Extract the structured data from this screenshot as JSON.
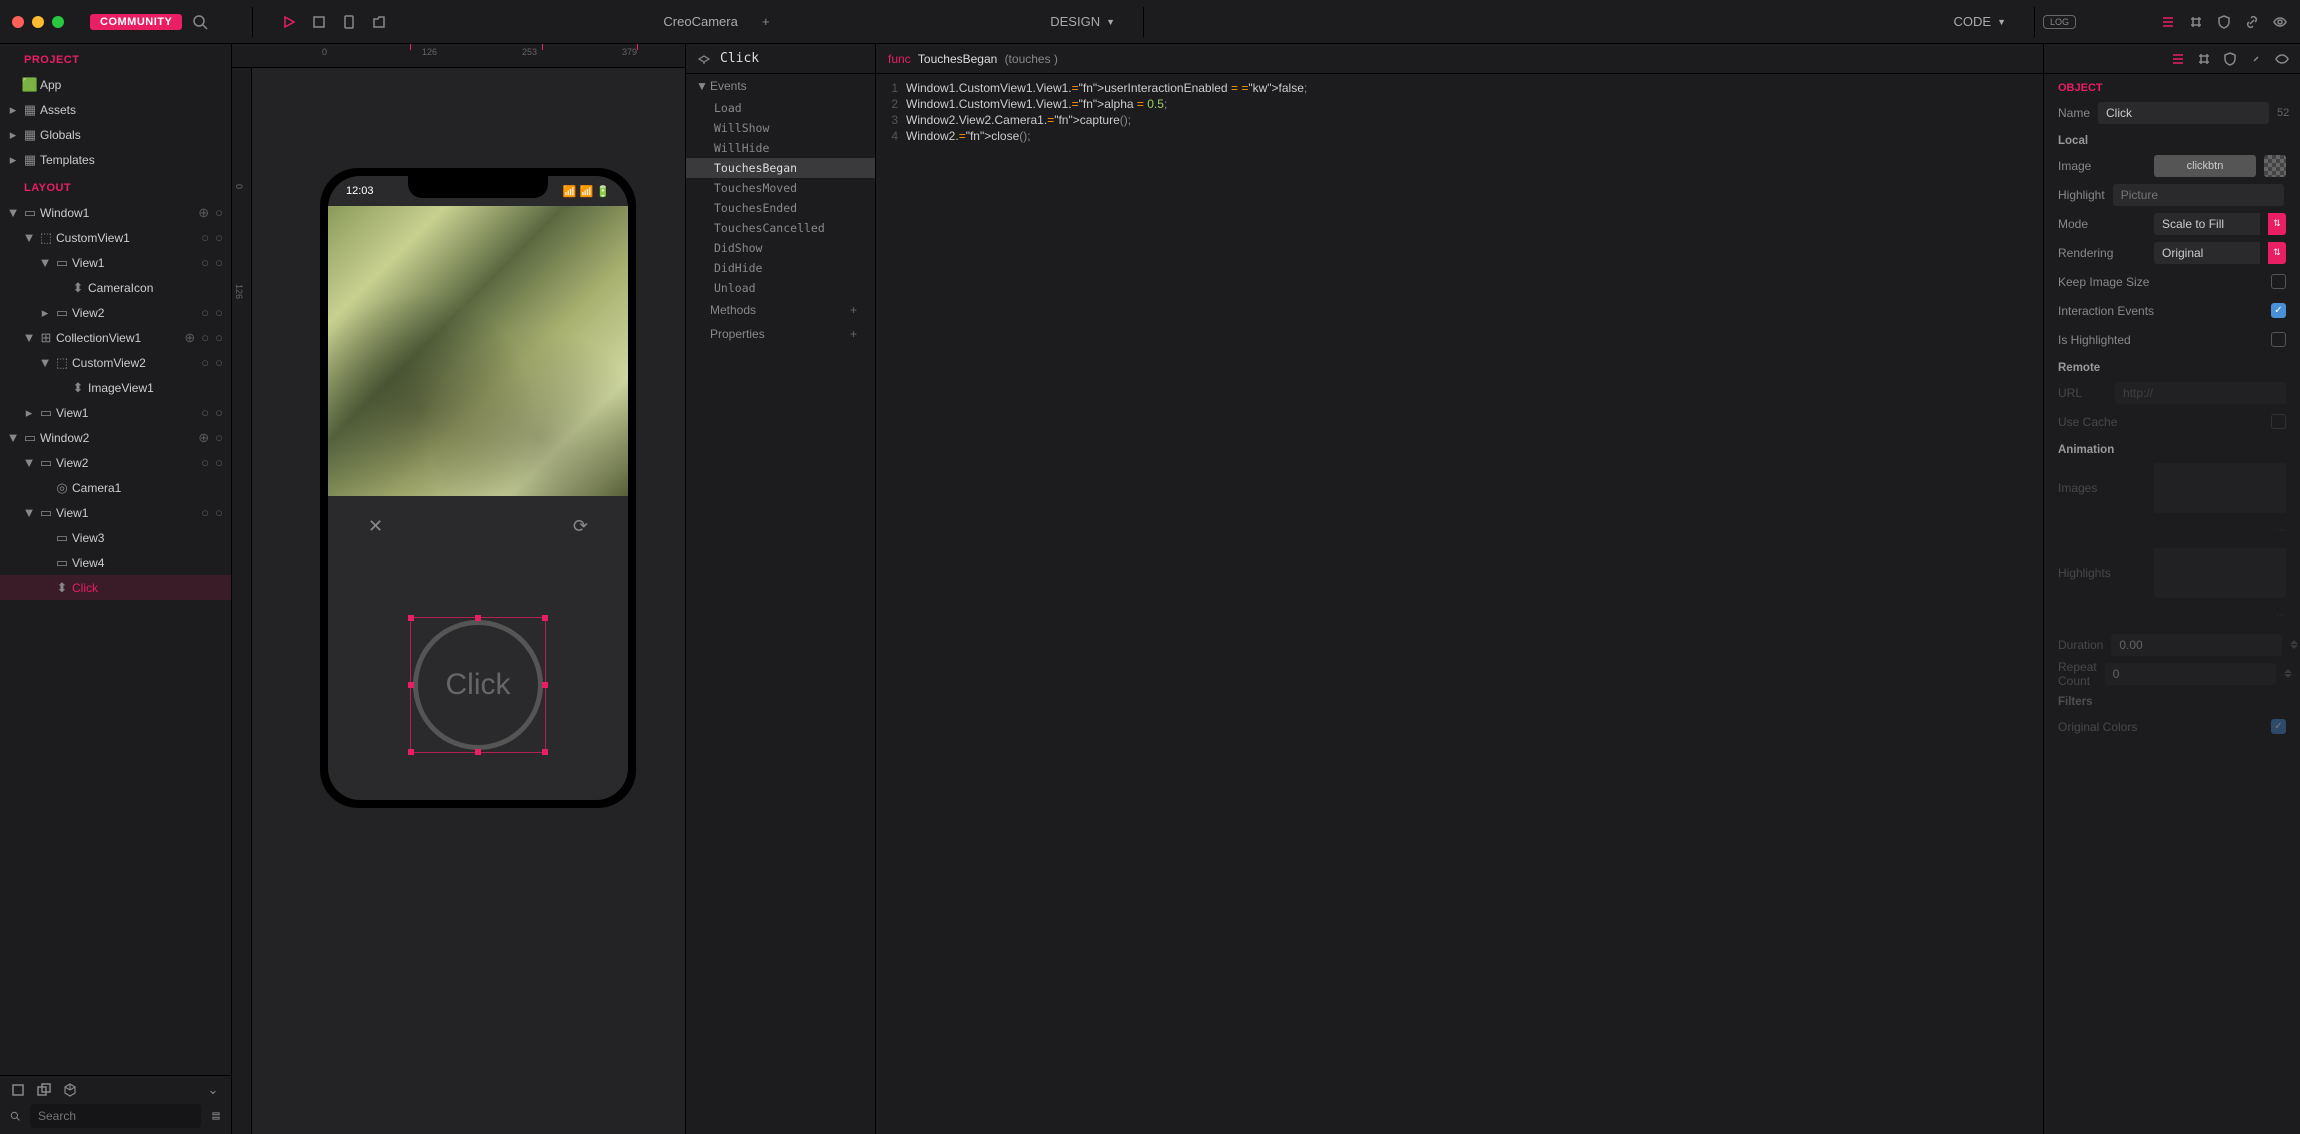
{
  "titlebar": {
    "community": "COMMUNITY",
    "projectName": "CreoCamera",
    "designMode": "DESIGN",
    "codeMode": "CODE",
    "log": "LOG"
  },
  "left": {
    "projectHdr": "PROJECT",
    "layoutHdr": "LAYOUT",
    "projectItems": [
      {
        "label": "App",
        "icon": "app"
      },
      {
        "label": "Assets",
        "icon": "folder"
      },
      {
        "label": "Globals",
        "icon": "globals"
      },
      {
        "label": "Templates",
        "icon": "templates"
      }
    ],
    "layoutTree": [
      {
        "label": "Window1",
        "ind": 0,
        "open": true,
        "icon": "window",
        "add": true,
        "dot": true
      },
      {
        "label": "CustomView1",
        "ind": 1,
        "open": true,
        "icon": "customview",
        "dot": true,
        "dot2": true
      },
      {
        "label": "View1",
        "ind": 2,
        "open": true,
        "icon": "view",
        "dot": true,
        "dot2": true
      },
      {
        "label": "CameraIcon",
        "ind": 3,
        "icon": "image"
      },
      {
        "label": "View2",
        "ind": 2,
        "closed": true,
        "icon": "view",
        "dot": true,
        "dot2": true
      },
      {
        "label": "CollectionView1",
        "ind": 1,
        "open": true,
        "icon": "collection",
        "add": true,
        "dot": true,
        "dot2": true
      },
      {
        "label": "CustomView2",
        "ind": 2,
        "open": true,
        "icon": "customview",
        "dot": true,
        "dot2": true
      },
      {
        "label": "ImageView1",
        "ind": 3,
        "icon": "image"
      },
      {
        "label": "View1",
        "ind": 1,
        "closed": true,
        "icon": "view",
        "dot": true,
        "dot2": true
      },
      {
        "label": "Window2",
        "ind": 0,
        "open": true,
        "icon": "window",
        "add": true,
        "dot": true
      },
      {
        "label": "View2",
        "ind": 1,
        "open": true,
        "icon": "view",
        "dot": true,
        "dot2": true
      },
      {
        "label": "Camera1",
        "ind": 2,
        "icon": "camera"
      },
      {
        "label": "View1",
        "ind": 1,
        "open": true,
        "icon": "view",
        "dot": true,
        "dot2": true
      },
      {
        "label": "View3",
        "ind": 2,
        "icon": "view"
      },
      {
        "label": "View4",
        "ind": 2,
        "icon": "view"
      },
      {
        "label": "Click",
        "ind": 2,
        "icon": "image",
        "selected": true
      }
    ],
    "searchPlaceholder": "Search"
  },
  "canvas": {
    "rulerTop": [
      "0",
      "126",
      "253",
      "379"
    ],
    "rulerLeft": [
      "0",
      "126"
    ],
    "statusTime": "12:03",
    "clickLabel": "Click"
  },
  "events": {
    "title": "Click",
    "sections": {
      "events": "Events",
      "methods": "Methods",
      "properties": "Properties"
    },
    "items": [
      "Load",
      "WillShow",
      "WillHide",
      "TouchesBegan",
      "TouchesMoved",
      "TouchesEnded",
      "TouchesCancelled",
      "DidShow",
      "DidHide",
      "Unload"
    ],
    "selected": "TouchesBegan"
  },
  "code": {
    "signature": {
      "kw": "func",
      "name": "TouchesBegan",
      "params": "(touches )"
    },
    "lines": [
      "Window1.CustomView1.View1.userInteractionEnabled = false;",
      "Window1.CustomView1.View1.alpha = 0.5;",
      "Window2.View2.Camera1.capture();",
      "Window2.close();"
    ]
  },
  "inspector": {
    "hdr": "OBJECT",
    "name": {
      "label": "Name",
      "value": "Click",
      "num": "52"
    },
    "local": "Local",
    "image": {
      "label": "Image",
      "value": "clickbtn"
    },
    "highlight": {
      "label": "Highlight",
      "placeholder": "Picture"
    },
    "mode": {
      "label": "Mode",
      "value": "Scale to Fill"
    },
    "rendering": {
      "label": "Rendering",
      "value": "Original"
    },
    "keepImageSize": {
      "label": "Keep Image Size",
      "on": false
    },
    "interactionEvents": {
      "label": "Interaction Events",
      "on": true
    },
    "isHighlighted": {
      "label": "Is Highlighted",
      "on": false
    },
    "remote": "Remote",
    "url": {
      "label": "URL",
      "placeholder": "http://"
    },
    "useCache": {
      "label": "Use Cache",
      "on": false
    },
    "animation": "Animation",
    "images": {
      "label": "Images"
    },
    "highlights": {
      "label": "Highlights"
    },
    "duration": {
      "label": "Duration",
      "value": "0.00"
    },
    "repeatCount": {
      "label": "Repeat Count",
      "value": "0"
    },
    "filters": "Filters",
    "originalColors": {
      "label": "Original Colors",
      "on": true
    }
  }
}
